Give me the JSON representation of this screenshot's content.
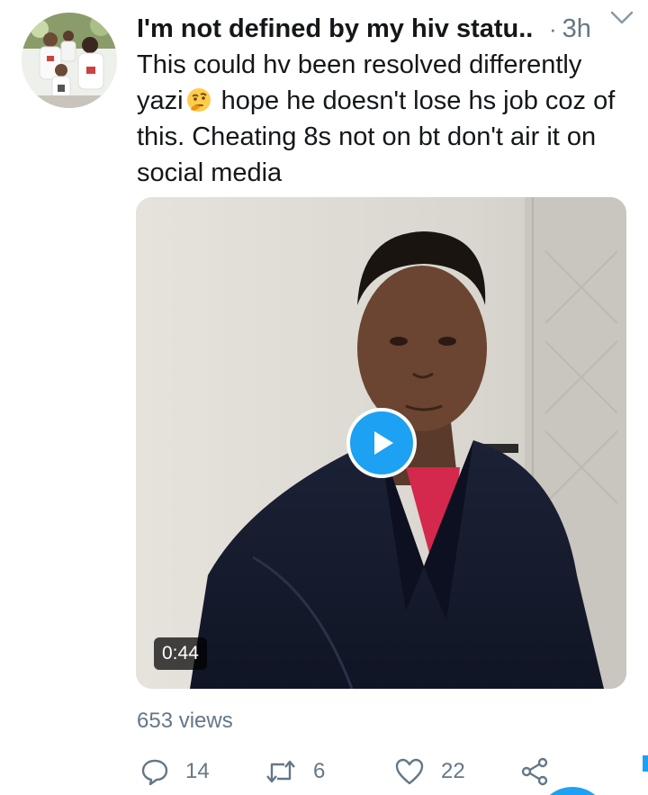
{
  "tweet": {
    "display_name": "I'm not defined by my hiv statu...",
    "separator": "·",
    "timestamp": "3h",
    "text_before_emoji": "This could hv been resolved differently yazi",
    "emoji": "thinking-face",
    "text_after_emoji": " hope he doesn't lose hs job coz of this. Cheating 8s not on bt don't air it on social media"
  },
  "video": {
    "duration": "0:44",
    "views": "653 views"
  },
  "actions": {
    "replies": "14",
    "retweets": "6",
    "likes": "22"
  },
  "icons": {
    "reply": "speech-bubble-icon",
    "retweet": "retweet-icon",
    "like": "heart-icon",
    "share": "share-icon",
    "caret": "chevron-down-icon",
    "play": "play-icon"
  },
  "colors": {
    "accent": "#1da1f2",
    "secondary_text": "#657786",
    "primary_text": "#14171a"
  }
}
